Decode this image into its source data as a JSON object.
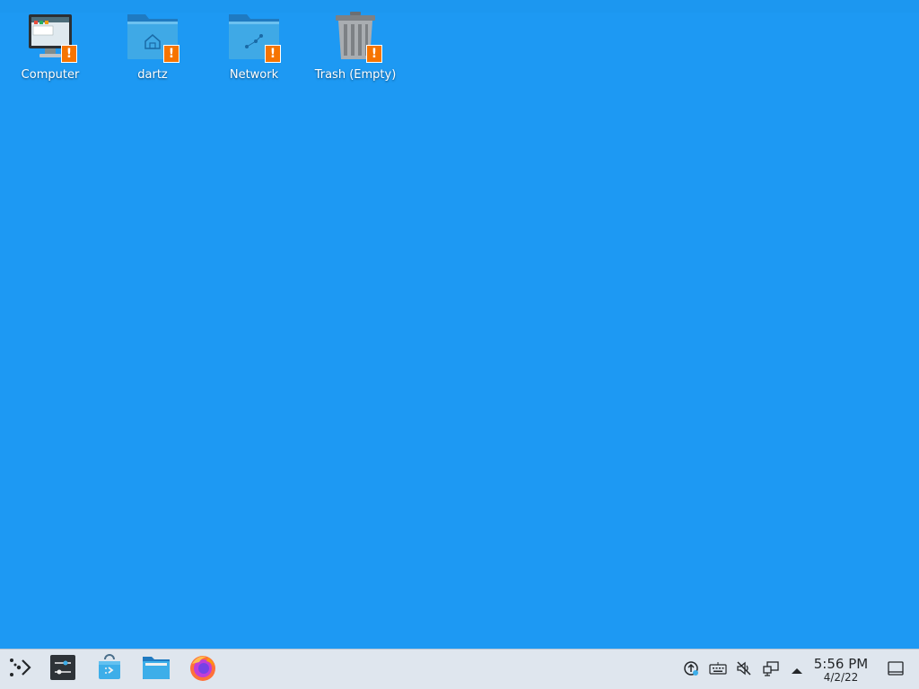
{
  "desktop": {
    "background_color": "#1d99f3",
    "icons": [
      {
        "label": "Computer",
        "icon": "computer-icon",
        "badge": "!"
      },
      {
        "label": "dartz",
        "icon": "home-folder-icon",
        "badge": "!"
      },
      {
        "label": "Network",
        "icon": "network-folder-icon",
        "badge": "!"
      },
      {
        "label": "Trash (Empty)",
        "icon": "trash-icon",
        "badge": "!"
      }
    ]
  },
  "taskbar": {
    "launchers": [
      {
        "icon": "application-launcher-icon"
      },
      {
        "icon": "system-settings-icon"
      },
      {
        "icon": "discover-store-icon"
      },
      {
        "icon": "file-manager-icon"
      },
      {
        "icon": "firefox-icon"
      }
    ],
    "tray": [
      {
        "icon": "updates-icon"
      },
      {
        "icon": "keyboard-icon"
      },
      {
        "icon": "volume-muted-icon"
      },
      {
        "icon": "network-wired-icon"
      },
      {
        "icon": "expand-tray-arrow-icon"
      }
    ],
    "clock": {
      "time": "5:56 PM",
      "date": "4/2/22"
    },
    "show_desktop": {
      "icon": "show-desktop-icon"
    }
  }
}
